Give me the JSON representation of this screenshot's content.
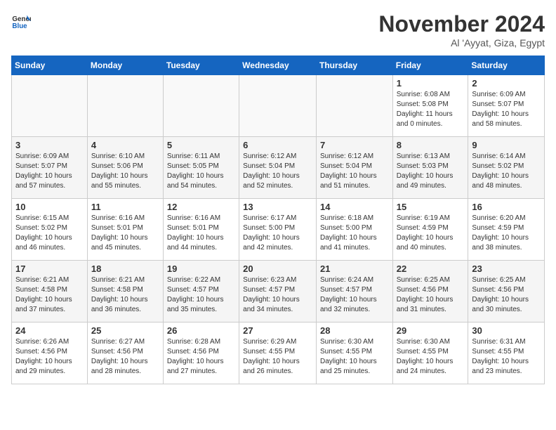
{
  "header": {
    "logo_general": "General",
    "logo_blue": "Blue",
    "month_title": "November 2024",
    "location": "Al 'Ayyat, Giza, Egypt"
  },
  "weekdays": [
    "Sunday",
    "Monday",
    "Tuesday",
    "Wednesday",
    "Thursday",
    "Friday",
    "Saturday"
  ],
  "weeks": [
    [
      {
        "day": "",
        "info": ""
      },
      {
        "day": "",
        "info": ""
      },
      {
        "day": "",
        "info": ""
      },
      {
        "day": "",
        "info": ""
      },
      {
        "day": "",
        "info": ""
      },
      {
        "day": "1",
        "info": "Sunrise: 6:08 AM\nSunset: 5:08 PM\nDaylight: 11 hours\nand 0 minutes."
      },
      {
        "day": "2",
        "info": "Sunrise: 6:09 AM\nSunset: 5:07 PM\nDaylight: 10 hours\nand 58 minutes."
      }
    ],
    [
      {
        "day": "3",
        "info": "Sunrise: 6:09 AM\nSunset: 5:07 PM\nDaylight: 10 hours\nand 57 minutes."
      },
      {
        "day": "4",
        "info": "Sunrise: 6:10 AM\nSunset: 5:06 PM\nDaylight: 10 hours\nand 55 minutes."
      },
      {
        "day": "5",
        "info": "Sunrise: 6:11 AM\nSunset: 5:05 PM\nDaylight: 10 hours\nand 54 minutes."
      },
      {
        "day": "6",
        "info": "Sunrise: 6:12 AM\nSunset: 5:04 PM\nDaylight: 10 hours\nand 52 minutes."
      },
      {
        "day": "7",
        "info": "Sunrise: 6:12 AM\nSunset: 5:04 PM\nDaylight: 10 hours\nand 51 minutes."
      },
      {
        "day": "8",
        "info": "Sunrise: 6:13 AM\nSunset: 5:03 PM\nDaylight: 10 hours\nand 49 minutes."
      },
      {
        "day": "9",
        "info": "Sunrise: 6:14 AM\nSunset: 5:02 PM\nDaylight: 10 hours\nand 48 minutes."
      }
    ],
    [
      {
        "day": "10",
        "info": "Sunrise: 6:15 AM\nSunset: 5:02 PM\nDaylight: 10 hours\nand 46 minutes."
      },
      {
        "day": "11",
        "info": "Sunrise: 6:16 AM\nSunset: 5:01 PM\nDaylight: 10 hours\nand 45 minutes."
      },
      {
        "day": "12",
        "info": "Sunrise: 6:16 AM\nSunset: 5:01 PM\nDaylight: 10 hours\nand 44 minutes."
      },
      {
        "day": "13",
        "info": "Sunrise: 6:17 AM\nSunset: 5:00 PM\nDaylight: 10 hours\nand 42 minutes."
      },
      {
        "day": "14",
        "info": "Sunrise: 6:18 AM\nSunset: 5:00 PM\nDaylight: 10 hours\nand 41 minutes."
      },
      {
        "day": "15",
        "info": "Sunrise: 6:19 AM\nSunset: 4:59 PM\nDaylight: 10 hours\nand 40 minutes."
      },
      {
        "day": "16",
        "info": "Sunrise: 6:20 AM\nSunset: 4:59 PM\nDaylight: 10 hours\nand 38 minutes."
      }
    ],
    [
      {
        "day": "17",
        "info": "Sunrise: 6:21 AM\nSunset: 4:58 PM\nDaylight: 10 hours\nand 37 minutes."
      },
      {
        "day": "18",
        "info": "Sunrise: 6:21 AM\nSunset: 4:58 PM\nDaylight: 10 hours\nand 36 minutes."
      },
      {
        "day": "19",
        "info": "Sunrise: 6:22 AM\nSunset: 4:57 PM\nDaylight: 10 hours\nand 35 minutes."
      },
      {
        "day": "20",
        "info": "Sunrise: 6:23 AM\nSunset: 4:57 PM\nDaylight: 10 hours\nand 34 minutes."
      },
      {
        "day": "21",
        "info": "Sunrise: 6:24 AM\nSunset: 4:57 PM\nDaylight: 10 hours\nand 32 minutes."
      },
      {
        "day": "22",
        "info": "Sunrise: 6:25 AM\nSunset: 4:56 PM\nDaylight: 10 hours\nand 31 minutes."
      },
      {
        "day": "23",
        "info": "Sunrise: 6:25 AM\nSunset: 4:56 PM\nDaylight: 10 hours\nand 30 minutes."
      }
    ],
    [
      {
        "day": "24",
        "info": "Sunrise: 6:26 AM\nSunset: 4:56 PM\nDaylight: 10 hours\nand 29 minutes."
      },
      {
        "day": "25",
        "info": "Sunrise: 6:27 AM\nSunset: 4:56 PM\nDaylight: 10 hours\nand 28 minutes."
      },
      {
        "day": "26",
        "info": "Sunrise: 6:28 AM\nSunset: 4:56 PM\nDaylight: 10 hours\nand 27 minutes."
      },
      {
        "day": "27",
        "info": "Sunrise: 6:29 AM\nSunset: 4:55 PM\nDaylight: 10 hours\nand 26 minutes."
      },
      {
        "day": "28",
        "info": "Sunrise: 6:30 AM\nSunset: 4:55 PM\nDaylight: 10 hours\nand 25 minutes."
      },
      {
        "day": "29",
        "info": "Sunrise: 6:30 AM\nSunset: 4:55 PM\nDaylight: 10 hours\nand 24 minutes."
      },
      {
        "day": "30",
        "info": "Sunrise: 6:31 AM\nSunset: 4:55 PM\nDaylight: 10 hours\nand 23 minutes."
      }
    ]
  ]
}
